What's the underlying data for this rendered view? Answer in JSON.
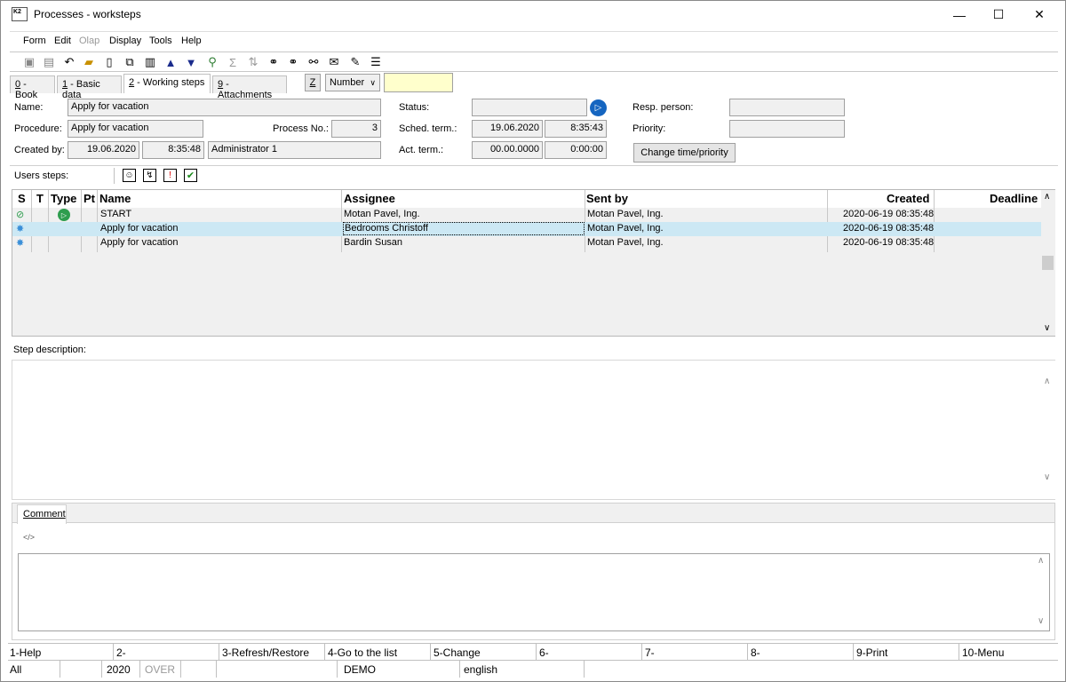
{
  "window": {
    "title": "Processes - worksteps"
  },
  "menu": [
    "Form",
    "Edit",
    "Olap",
    "Display",
    "Tools",
    "Help"
  ],
  "tabs": [
    {
      "key": "0",
      "label": " - Book"
    },
    {
      "key": "1",
      "label": " - Basic data"
    },
    {
      "key": "2",
      "label": " - Working steps"
    },
    {
      "key": "9",
      "label": " - Attachments"
    }
  ],
  "sort": {
    "key_label": "Z",
    "selected": "Number"
  },
  "form": {
    "name_label": "Name:",
    "name_value": "Apply for vacation",
    "procedure_label": "Procedure:",
    "procedure_value": "Apply for vacation",
    "process_no_label": "Process No.:",
    "process_no_value": "3",
    "created_by_label": "Created by:",
    "created_date": "19.06.2020",
    "created_time": "8:35:48",
    "created_user": "Administrator 1",
    "status_label": "Status:",
    "status_value": "",
    "sched_label": "Sched. term.:",
    "sched_date": "19.06.2020",
    "sched_time": "8:35:43",
    "act_label": "Act. term.:",
    "act_date": "00.00.0000",
    "act_time": "0:00:00",
    "resp_label": "Resp. person:",
    "resp_value": "",
    "priority_label": "Priority:",
    "priority_value": "",
    "change_button": "Change time/priority",
    "users_steps_label": "Users steps:"
  },
  "grid": {
    "columns": [
      "S",
      "T",
      "Type",
      "Pt",
      "Name",
      "Assignee",
      "Sent by",
      "Created",
      "Deadline"
    ],
    "rows": [
      {
        "name": "START",
        "assignee": "Motan Pavel, Ing.",
        "sent_by": "Motan Pavel, Ing.",
        "created": "2020-06-19 08:35:48",
        "deadline": ""
      },
      {
        "name": "Apply for vacation",
        "assignee": "Bedrooms Christoff",
        "sent_by": "Motan Pavel, Ing.",
        "created": "2020-06-19 08:35:48",
        "deadline": ""
      },
      {
        "name": "Apply for vacation",
        "assignee": "Bardin Susan",
        "sent_by": "Motan Pavel, Ing.",
        "created": "2020-06-19 08:35:48",
        "deadline": ""
      }
    ]
  },
  "step_description_label": "Step description:",
  "comment_tab": "Comment",
  "fkeys": [
    "1-Help",
    "2-",
    "3-Refresh/Restore",
    "4-Go to the list",
    "5-Change",
    "6-",
    "7-",
    "8-",
    "9-Print",
    "10-Menu"
  ],
  "statusbar": {
    "filter": "All",
    "year": "2020",
    "mode": "OVER",
    "company": "DEMO",
    "language": "english"
  },
  "colors": {
    "selection": "#cce8f4",
    "accent_blue": "#1565c0",
    "green": "#2e9d4e"
  }
}
